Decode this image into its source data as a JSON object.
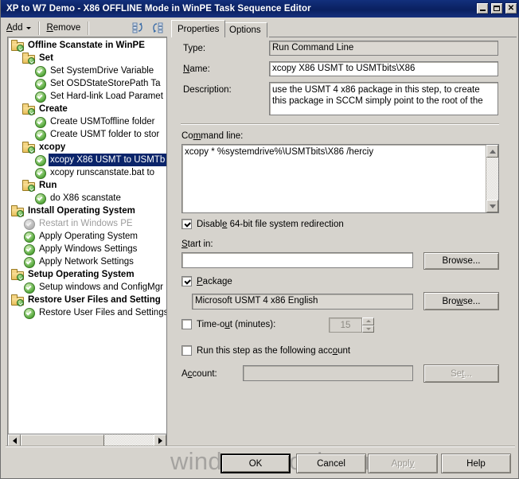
{
  "window": {
    "title": "XP to W7 Demo - X86 OFFLINE Mode in WinPE Task Sequence Editor",
    "minimize_label": "Minimize",
    "maximize_label": "Maximize",
    "close_label": "Close"
  },
  "toolbar": {
    "add_label": "Add",
    "remove_label": "Remove",
    "move_up_label": "Move Up",
    "move_down_label": "Move Down"
  },
  "tabs": [
    {
      "label": "Properties",
      "active": true
    },
    {
      "label": "Options",
      "active": false
    }
  ],
  "tree": {
    "items": [
      {
        "label": "Offline Scanstate in WinPE",
        "indent": 0,
        "type": "folder",
        "selected": false,
        "disabled": false
      },
      {
        "label": "Set",
        "indent": 1,
        "type": "folder",
        "selected": false,
        "disabled": false
      },
      {
        "label": "Set SystemDrive Variable",
        "indent": 2,
        "type": "step",
        "selected": false,
        "disabled": false
      },
      {
        "label": "Set OSDStateStorePath Ta",
        "indent": 2,
        "type": "step",
        "selected": false,
        "disabled": false
      },
      {
        "label": "Set Hard-link Load Paramet",
        "indent": 2,
        "type": "step",
        "selected": false,
        "disabled": false
      },
      {
        "label": "Create",
        "indent": 1,
        "type": "folder",
        "selected": false,
        "disabled": false
      },
      {
        "label": "Create USMToffline folder",
        "indent": 2,
        "type": "step",
        "selected": false,
        "disabled": false
      },
      {
        "label": "Create USMT folder to stor",
        "indent": 2,
        "type": "step",
        "selected": false,
        "disabled": false
      },
      {
        "label": "xcopy",
        "indent": 1,
        "type": "folder",
        "selected": false,
        "disabled": false
      },
      {
        "label": "xcopy X86 USMT to USMTb",
        "indent": 2,
        "type": "step",
        "selected": true,
        "disabled": false
      },
      {
        "label": "xcopy runscanstate.bat to",
        "indent": 2,
        "type": "step",
        "selected": false,
        "disabled": false
      },
      {
        "label": "Run",
        "indent": 1,
        "type": "folder",
        "selected": false,
        "disabled": false
      },
      {
        "label": "do X86 scanstate",
        "indent": 2,
        "type": "step",
        "selected": false,
        "disabled": false
      },
      {
        "label": "Install Operating System",
        "indent": 0,
        "type": "folder",
        "selected": false,
        "disabled": false
      },
      {
        "label": "Restart in Windows PE",
        "indent": 1,
        "type": "step",
        "selected": false,
        "disabled": true
      },
      {
        "label": "Apply Operating System",
        "indent": 1,
        "type": "step",
        "selected": false,
        "disabled": false
      },
      {
        "label": "Apply Windows Settings",
        "indent": 1,
        "type": "step",
        "selected": false,
        "disabled": false
      },
      {
        "label": "Apply Network Settings",
        "indent": 1,
        "type": "step",
        "selected": false,
        "disabled": false
      },
      {
        "label": "Setup Operating System",
        "indent": 0,
        "type": "folder",
        "selected": false,
        "disabled": false
      },
      {
        "label": "Setup windows and ConfigMgr",
        "indent": 1,
        "type": "step",
        "selected": false,
        "disabled": false
      },
      {
        "label": "Restore User Files and Setting",
        "indent": 0,
        "type": "folder",
        "selected": false,
        "disabled": false
      },
      {
        "label": "Restore User Files and Settings",
        "indent": 1,
        "type": "step",
        "selected": false,
        "disabled": false
      }
    ]
  },
  "properties": {
    "type_label": "Type:",
    "type_value": "Run Command Line",
    "name_label": "Name:",
    "name_value": "xcopy X86 USMT to USMTbits\\X86",
    "description_label": "Description:",
    "description_value": "use the USMT 4  x86 package in this step, to create this package in SCCM simply point to the root of the",
    "command_line_label": "Command line:",
    "command_line_value": "xcopy * %systemdrive%\\USMTbits\\X86 /herciy",
    "disable_redirection_label": "Disable 64-bit file system redirection",
    "disable_redirection_checked": true,
    "start_in_label": "Start in:",
    "start_in_value": "",
    "start_in_browse_label": "Browse...",
    "package_label": "Package",
    "package_checked": true,
    "package_value": "Microsoft USMT 4 x86 English",
    "package_browse_label": "Browse...",
    "timeout_label": "Time-out (minutes):",
    "timeout_checked": false,
    "timeout_value": "15",
    "run_as_label": "Run this step as the following account",
    "run_as_checked": false,
    "account_label": "Account:",
    "account_value": "",
    "set_label": "Set..."
  },
  "footer": {
    "ok_label": "OK",
    "cancel_label": "Cancel",
    "apply_label": "Apply",
    "help_label": "Help"
  },
  "watermark": {
    "text": "windows-noob.com"
  }
}
